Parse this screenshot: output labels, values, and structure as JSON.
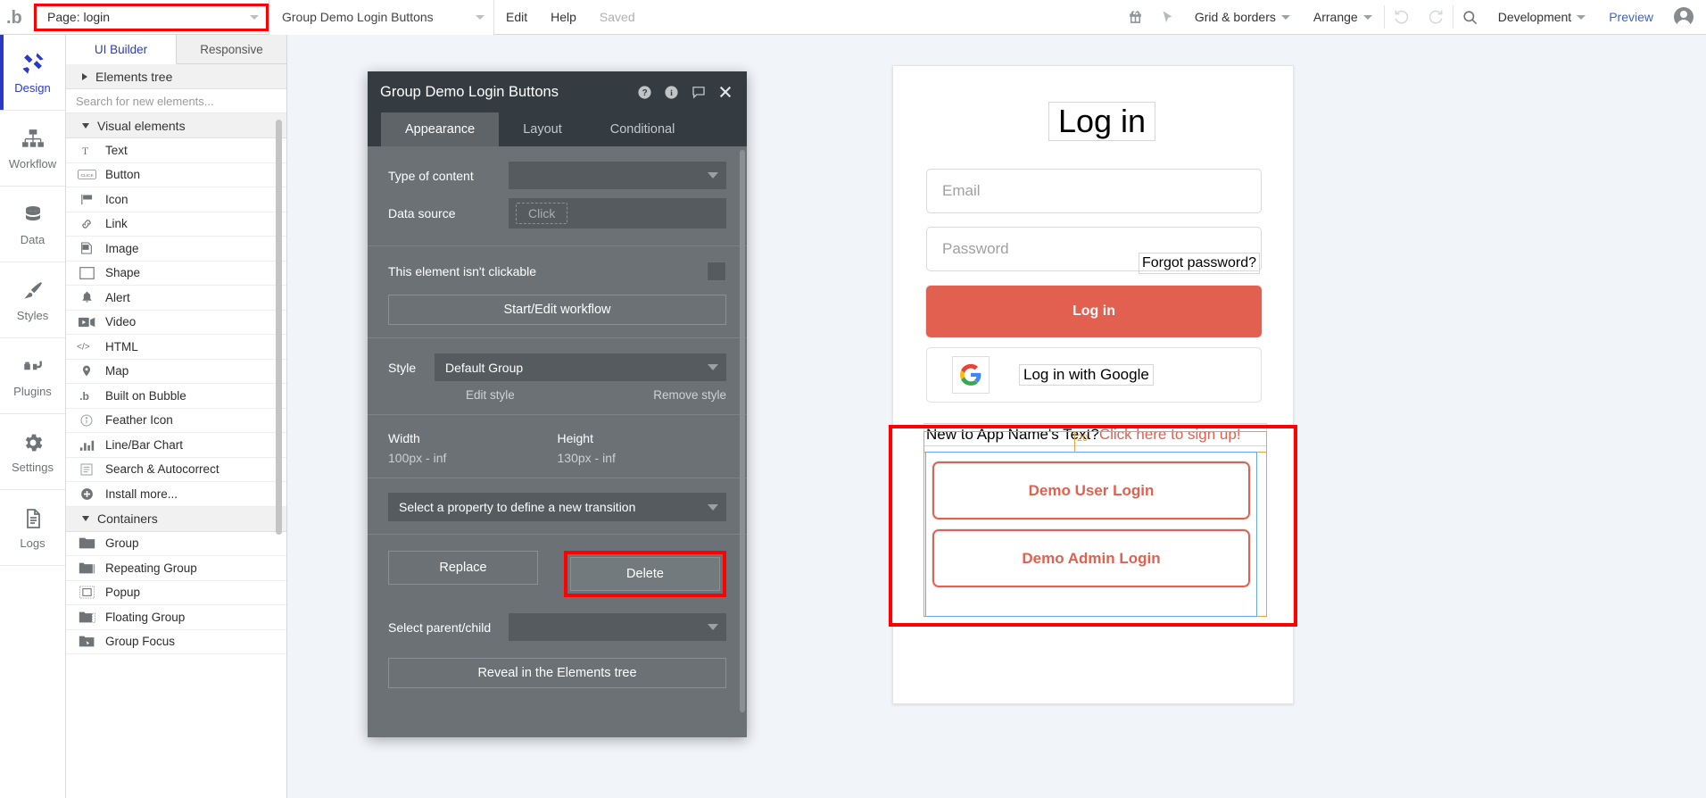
{
  "topbar": {
    "logo_icon": "bubble-logo-icon",
    "page_select": {
      "value": "Page: login",
      "caret_icon": "chevron-down-icon"
    },
    "element_select": {
      "value": "Group Demo Login Buttons",
      "caret_icon": "chevron-down-icon"
    },
    "edit_label": "Edit",
    "help_label": "Help",
    "saved_label": "Saved",
    "gift_icon": "gift-icon",
    "cursor_icon": "cursor-arrow-icon",
    "grid_borders_label": "Grid & borders",
    "arrange_label": "Arrange",
    "undo_icon": "undo-icon",
    "redo_icon": "redo-icon",
    "search_icon": "search-icon",
    "version_label": "Development",
    "preview_label": "Preview",
    "avatar_icon": "user-avatar-icon"
  },
  "rail": {
    "items": [
      {
        "label": "Design",
        "icon": "design-icon",
        "active": true
      },
      {
        "label": "Workflow",
        "icon": "workflow-icon",
        "active": false
      },
      {
        "label": "Data",
        "icon": "database-icon",
        "active": false
      },
      {
        "label": "Styles",
        "icon": "paintbrush-icon",
        "active": false
      },
      {
        "label": "Plugins",
        "icon": "plug-icon",
        "active": false
      },
      {
        "label": "Settings",
        "icon": "gear-icon",
        "active": false
      },
      {
        "label": "Logs",
        "icon": "document-icon",
        "active": false
      }
    ]
  },
  "elements_panel": {
    "tabs": [
      {
        "label": "UI Builder",
        "active": true
      },
      {
        "label": "Responsive",
        "active": false
      }
    ],
    "elements_tree_label": "Elements tree",
    "search_placeholder": "Search for new elements...",
    "visual_elements_label": "Visual elements",
    "visual_elements": [
      {
        "label": "Text",
        "icon": "text-t-icon"
      },
      {
        "label": "Button",
        "icon": "button-click-icon"
      },
      {
        "label": "Icon",
        "icon": "flag-icon"
      },
      {
        "label": "Link",
        "icon": "link-chain-icon"
      },
      {
        "label": "Image",
        "icon": "image-icon"
      },
      {
        "label": "Shape",
        "icon": "shape-rectangle-icon"
      },
      {
        "label": "Alert",
        "icon": "bell-icon"
      },
      {
        "label": "Video",
        "icon": "video-camera-icon"
      },
      {
        "label": "HTML",
        "icon": "code-brackets-icon"
      },
      {
        "label": "Map",
        "icon": "map-pin-icon"
      },
      {
        "label": "Built on Bubble",
        "icon": "bubble-logo-icon"
      },
      {
        "label": "Feather Icon",
        "icon": "info-circle-icon"
      },
      {
        "label": "Line/Bar Chart",
        "icon": "bar-chart-icon"
      },
      {
        "label": "Search & Autocorrect",
        "icon": "list-box-icon"
      },
      {
        "label": "Install more...",
        "icon": "plus-circle-icon"
      }
    ],
    "containers_label": "Containers",
    "containers": [
      {
        "label": "Group",
        "icon": "folder-icon"
      },
      {
        "label": "Repeating Group",
        "icon": "folder-repeat-icon"
      },
      {
        "label": "Popup",
        "icon": "popup-icon"
      },
      {
        "label": "Floating Group",
        "icon": "folder-float-icon"
      },
      {
        "label": "Group Focus",
        "icon": "folder-focus-icon"
      }
    ]
  },
  "property_editor": {
    "title": "Group Demo Login Buttons",
    "header_icons": [
      "help-circle-icon",
      "info-circle-icon",
      "comment-bubble-icon",
      "close-icon"
    ],
    "tabs": [
      {
        "label": "Appearance",
        "active": true
      },
      {
        "label": "Layout",
        "active": false
      },
      {
        "label": "Conditional",
        "active": false
      }
    ],
    "type_of_content_label": "Type of content",
    "type_of_content_value": "",
    "data_source_label": "Data source",
    "data_source_value": "Click",
    "not_clickable_label": "This element isn't clickable",
    "start_edit_workflow_label": "Start/Edit workflow",
    "style_label": "Style",
    "style_value": "Default Group",
    "edit_style_label": "Edit style",
    "remove_style_label": "Remove style",
    "width_label": "Width",
    "width_value": "100px - inf",
    "height_label": "Height",
    "height_value": "130px - inf",
    "transition_placeholder": "Select a property to define a new transition",
    "replace_label": "Replace",
    "delete_label": "Delete",
    "select_parent_child_label": "Select parent/child",
    "select_parent_child_value": "",
    "reveal_label": "Reveal in the Elements tree"
  },
  "canvas": {
    "login_form": {
      "title": "Log in",
      "email_placeholder": "Email",
      "password_placeholder": "Password",
      "forgot_password_label": "Forgot password?",
      "login_button_label": "Log in",
      "google_button_label": "Log in with Google",
      "google_icon": "google-g-icon",
      "signup_prefix": "New to App Name's Text? ",
      "signup_link": "Click here to sign up!",
      "spacing_value": "20",
      "demo_user_button_label": "Demo User Login",
      "demo_admin_button_label": "Demo Admin Login"
    }
  },
  "colors": {
    "accent_red": "#e1604f",
    "selection_red": "#ff0000",
    "bubble_blue": "#2b39c9",
    "measure_orange": "#e8a33d",
    "group_blue": "#63a8e8",
    "panel_grey": "#6b7174",
    "panel_dark": "#343c41"
  }
}
